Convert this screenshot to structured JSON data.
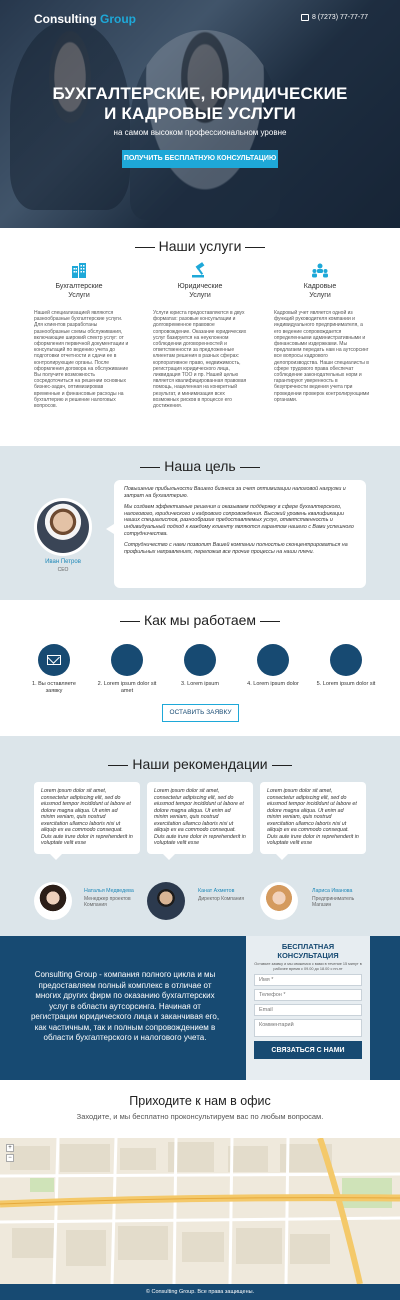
{
  "header": {
    "logo_main": "Consulting",
    "logo_accent": "Group",
    "phone": "8 (7273) 77-77-77"
  },
  "hero": {
    "title_line1": "БУХГАЛТЕРСКИЕ, ЮРИДИЧЕСКИЕ",
    "title_line2": "И КАДРОВЫЕ УСЛУГИ",
    "subtitle": "на самом высоком профессиональном уровне",
    "cta_label": "ПОЛУЧИТЬ БЕСПЛАТНУЮ КОНСУЛЬТАЦИЮ"
  },
  "services": {
    "title": "Наши услуги",
    "items": [
      {
        "title_line1": "Бухгалтерские",
        "title_line2": "Услуги",
        "icon": "building-icon",
        "text": "Нашей специализацией являются разнообразные бухгалтерские услуги. Для клиентов разработаны разнообразные схемы обслуживания, включающие широкий спектр услуг: от оформления первичной документации и консультаций по ведению учета до подготовки отчетности и сдачи ее в контролирующие органы. После оформления договора на обслуживание Вы получите возможность сосредоточиться на решении основных бизнес-задач, оптимизировав временные и финансовые расходы на бухгалтерию и решение налоговых вопросов."
      },
      {
        "title_line1": "Юридические",
        "title_line2": "Услуги",
        "icon": "gavel-icon",
        "text": "Услуги юриста предоставляются в двух форматах: разовые консультации и долговременное правовое сопровождение. Оказание юридических услуг базируется на неуклонном соблюдении договоренностей и ответственности за предложенные клиентам решения в разных сферах: корпоративное право, недвижимость, регистрация юридического лица, ликвидация ТОО и пр. Нашей целью является квалифицированная правовая помощь, нацеленная на конкретный результат, и минимизация всех возможных рисков в процессе его достижения."
      },
      {
        "title_line1": "Кадровые",
        "title_line2": "Услуги",
        "icon": "team-icon",
        "text": "Кадровый учет является одной из функций руководителя компании и индивидуального предпринимателя, а его ведение сопровождается определенными административными и финансовыми издержками. Мы предлагаем передать нам на аутсорсинг все вопросы кадрового делопроизводства. Наши специалисты в сфере трудового права обеспечат соблюдение законодательных норм и гарантируют уверенность в безупречности ведения учета при проведении проверок контролирующими органами."
      }
    ]
  },
  "goal": {
    "title": "Наша цель",
    "ceo_name": "Иван Петров",
    "ceo_role": "CEO",
    "paragraphs": [
      "Повышение прибыльности Вашего бизнеса за счет оптимизации налоговой нагрузки и затрат на бухгалтерию.",
      "Мы создаем эффективные решения и оказываем поддержку в сфере бухгалтерского, налогового, юридического и кадрового сопровождения. Высокий уровень квалификации наших специалистов, разнообразие предоставляемых услуг, ответственность и индивидуальный подход к каждому клиенту являются гарантом нашего с Вами успешного сотрудничества.",
      "Сотрудничество с нами позволит Вашей компании полностью сконцентрироваться на профильных направлениях, переложив все прочие процессы на наши плечи."
    ]
  },
  "how": {
    "title": "Как мы работаем",
    "steps": [
      {
        "label": "1. Вы оставляете заявку"
      },
      {
        "label": "2. Lorem ipsum dolor sit amet"
      },
      {
        "label": "3. Lorem ipsum"
      },
      {
        "label": "4. Lorem ipsum dolor"
      },
      {
        "label": "5. Lorem ipsum dolor sit"
      }
    ],
    "button_label": "ОСТАВИТЬ ЗАЯВКУ"
  },
  "recs": {
    "title": "Наши рекомендации",
    "quote": "Lorem ipsum dolor sit amet, consectetur adipiscing elit, sed do eiusmod tempor incididunt ut labore et dolore magna aliqua. Ut enim ad minim veniam, quis nostrud exercitation ullamco laboris nisi ut aliquip ex ea commodo consequat. Duis aute irure dolor in reprehenderit in voluptate velit esse",
    "items": [
      {
        "name": "Наталья Медведева",
        "role": "Менеджер проектов Компания"
      },
      {
        "name": "Канат Ахметов",
        "role": "Директор Компания"
      },
      {
        "name": "Лариса Иванова",
        "role": "Предприниматель Магазин"
      }
    ]
  },
  "cta": {
    "text": "Consulting Group - компания полного цикла и мы предоставляем полный комплекс в отличае от многих других фирм по оказанию бухгалтерских услуг в области аутсорсинга. Начиная от регистрации юридического лица и заканчивая его, как частичным, так и полным сопровождением в области бухгалтерского и налогового учета.",
    "form_title": "БЕСПЛАТНАЯ КОНСУЛЬТАЦИЯ",
    "form_note": "Оставьте заявку и мы свяжемся с вами в течение 15 минут в рабочее время с 09.00 до 18.00 с пн-пт",
    "name_placeholder": "Имя *",
    "phone_placeholder": "Телефон *",
    "email_placeholder": "Email",
    "comment_placeholder": "Комментарий",
    "submit_label": "СВЯЗАТЬСЯ С НАМИ"
  },
  "office": {
    "title": "Приходите к нам в офис",
    "subtitle": "Заходите, и мы бесплатно проконсультируем вас по любым вопросам."
  },
  "footer": {
    "copyright": "© Consulting Group. Все права защищены."
  },
  "colors": {
    "accent": "#1ea8d8",
    "navy": "#174a72",
    "light_section": "#dce5ea"
  }
}
